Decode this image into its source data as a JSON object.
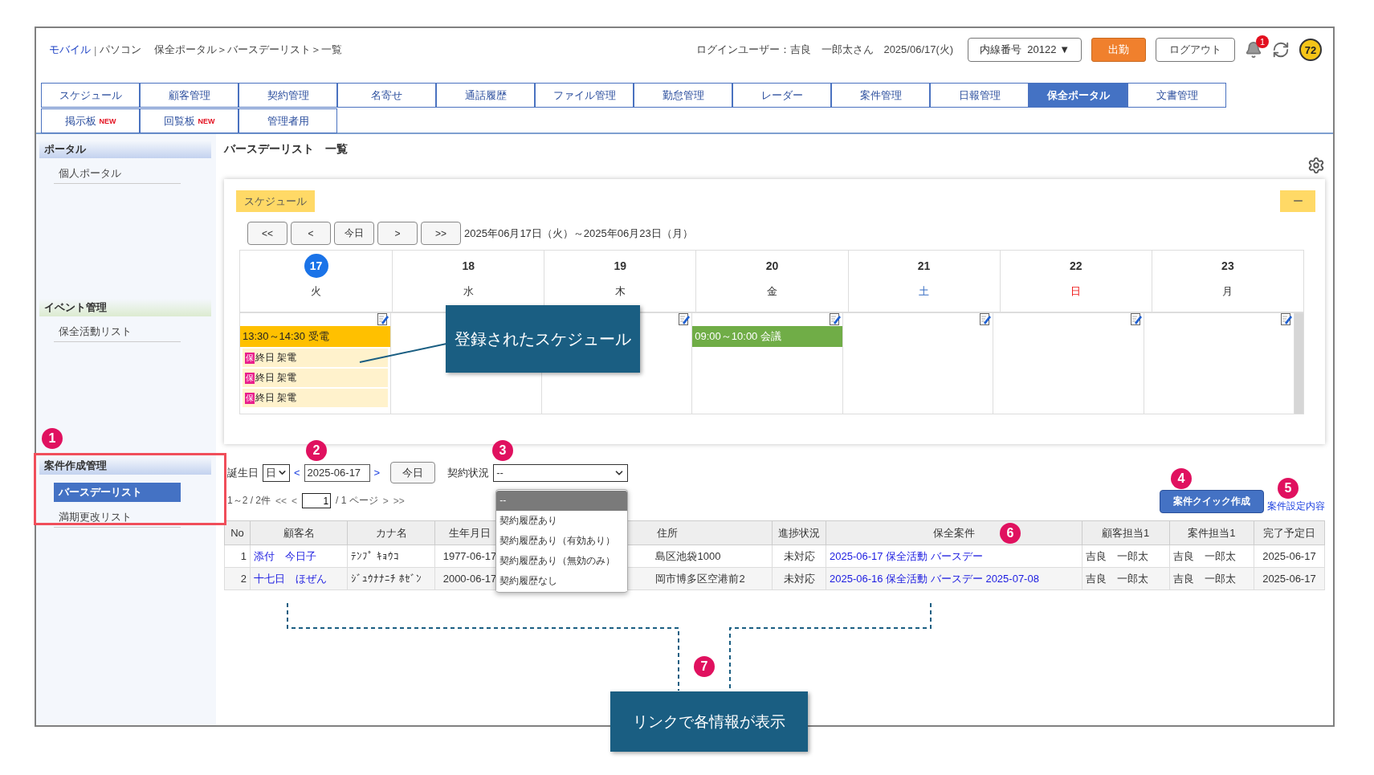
{
  "header": {
    "modes": [
      {
        "label": "モバイル",
        "kind": "link"
      },
      {
        "label": "パソコン",
        "kind": "text"
      }
    ],
    "separator": "|",
    "breadcrumb": "保全ポータル＞バースデーリスト＞一覧",
    "user": "ログインユーザー：吉良　一郎太さん",
    "date": "2025/06/17(火)",
    "extension": "内線番号  20122 ▼",
    "clock_in": "出勤",
    "logout": "ログアウト",
    "notifications": "1",
    "points": "72"
  },
  "tabs": [
    {
      "label": "スケジュール",
      "selected": false
    },
    {
      "label": "顧客管理",
      "selected": false
    },
    {
      "label": "契約管理",
      "selected": false
    },
    {
      "label": "名寄せ",
      "selected": false
    },
    {
      "label": "通話履歴",
      "selected": false
    },
    {
      "label": "ファイル管理",
      "selected": false
    },
    {
      "label": "勤怠管理",
      "selected": false
    },
    {
      "label": "レーダー",
      "selected": false
    },
    {
      "label": "案件管理",
      "selected": false
    },
    {
      "label": "日報管理",
      "selected": false
    },
    {
      "label": "保全ポータル",
      "selected": true
    },
    {
      "label": "文書管理",
      "selected": false
    },
    {
      "label": "掲示板",
      "badge": "NEW",
      "selected": false
    },
    {
      "label": "回覧板",
      "badge": "NEW",
      "selected": false
    },
    {
      "label": "管理者用",
      "selected": false
    }
  ],
  "sidebar": {
    "sections": [
      {
        "title": "ポータル",
        "color": "#c3d2ef",
        "items": [
          {
            "label": "個人ポータル",
            "selected": false
          }
        ]
      },
      {
        "title": "イベント管理",
        "color": "#dcebd0",
        "items": [
          {
            "label": "保全活動リスト",
            "selected": false
          }
        ]
      },
      {
        "title": "案件作成管理",
        "color": "#c3d2ef",
        "items": [
          {
            "label": "バースデーリスト",
            "selected": true
          },
          {
            "label": "満期更改リスト",
            "selected": false
          }
        ]
      }
    ]
  },
  "page_title": "バースデーリスト　一覧",
  "schedule": {
    "label": "スケジュール",
    "collapse": "ー",
    "nav": [
      "<<",
      "<",
      "今日",
      ">",
      ">>"
    ],
    "range": "2025年06月17日（火）～2025年06月23日（月）",
    "days": [
      {
        "date": "17",
        "weekday": "火",
        "kind": "weekday",
        "today": true,
        "edit": true,
        "events": [
          {
            "kind": "reception",
            "text": "13:30～14:30 受電"
          },
          {
            "kind": "allday",
            "tag": "保",
            "text": "終日 架電"
          },
          {
            "kind": "allday",
            "tag": "保",
            "text": "終日 架電"
          },
          {
            "kind": "allday",
            "tag": "保",
            "text": "終日 架電"
          }
        ]
      },
      {
        "date": "18",
        "weekday": "水",
        "kind": "weekday",
        "today": false
      },
      {
        "date": "19",
        "weekday": "木",
        "kind": "weekday",
        "today": false,
        "edit": true
      },
      {
        "date": "20",
        "weekday": "金",
        "kind": "weekday",
        "today": false,
        "edit": true,
        "events": [
          {
            "kind": "meeting",
            "text": "09:00～10:00 会議"
          }
        ]
      },
      {
        "date": "21",
        "weekday": "土",
        "kind": "saturday",
        "today": false,
        "edit": true
      },
      {
        "date": "22",
        "weekday": "日",
        "kind": "sunday",
        "today": false,
        "edit": true
      },
      {
        "date": "23",
        "weekday": "月",
        "kind": "weekday",
        "today": false,
        "edit": true
      }
    ]
  },
  "filter": {
    "birthday_label": "誕生日",
    "unit": "日",
    "prev": "<",
    "date": "2025-06-17",
    "next": ">",
    "today": "今日",
    "contract_label": "契約状況",
    "contract_value": "--",
    "contract_options": [
      {
        "label": "--",
        "selected": true
      },
      {
        "label": "契約履歴あり",
        "selected": false
      },
      {
        "label": "契約履歴あり（有効あり）",
        "selected": false
      },
      {
        "label": "契約履歴あり（無効のみ）",
        "selected": false
      },
      {
        "label": "契約履歴なし",
        "selected": false
      }
    ]
  },
  "pager": {
    "summary": "1～2 / 2件",
    "first": "<<",
    "prev": "<",
    "page": "1",
    "total": "/ 1 ページ",
    "next": ">",
    "last": ">>"
  },
  "actions": {
    "quick_create": "案件クイック作成",
    "settings_link": "案件設定内容"
  },
  "table": {
    "columns": [
      "No",
      "顧客名",
      "カナ名",
      "生年月日",
      "住所",
      "進捗状況",
      "保全案件",
      "顧客担当1",
      "案件担当1",
      "完了予定日"
    ],
    "rows": [
      {
        "no": "1",
        "customer": "添付　今日子",
        "kana": "ﾃﾝﾌﾟ ｷｮｳｺ",
        "birth": "1977-06-17",
        "address": "島区池袋1000",
        "status": "未対応",
        "case": "2025-06-17 保全活動 バースデー",
        "staff1": "吉良　一郎太",
        "staff2": "吉良　一郎太",
        "due": "2025-06-17"
      },
      {
        "no": "2",
        "customer": "十七日　ほぜん",
        "kana": "ｼﾞｭｳﾅﾅﾆﾁ ﾎｾﾞﾝ",
        "birth": "2000-06-17",
        "address": "岡市博多区空港前2",
        "status": "未対応",
        "case": "2025-06-16 保全活動 バースデー 2025-07-08",
        "staff1": "吉良　一郎太",
        "staff2": "吉良　一郎太",
        "due": "2025-06-17"
      }
    ]
  },
  "annotations": {
    "markers": [
      "1",
      "2",
      "3",
      "4",
      "5",
      "6",
      "7"
    ],
    "callouts": [
      "登録されたスケジュール",
      "リンクで各情報が表示"
    ]
  }
}
